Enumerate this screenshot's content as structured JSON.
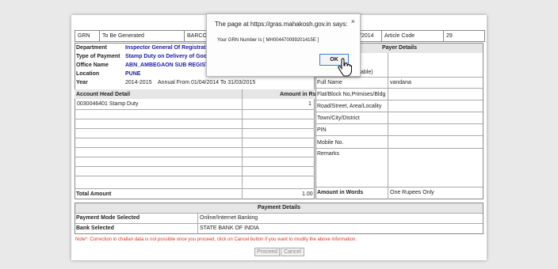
{
  "topbar": {
    "grn_label": "GRN",
    "grn_value": "To Be Generated",
    "barcode_label": "BARCOD",
    "date_value": "/2014",
    "article_label": "Article Code",
    "article_value": "29"
  },
  "department_info": {
    "department_label": "Department",
    "department_value": "Inspector General Of Registration",
    "type_label": "Type of Payment",
    "type_value": "Stamp Duty on Delivery of Goods",
    "office_label": "Office Name",
    "office_value": "ABN_AMBEGAON SUB REGISTRAR",
    "location_label": "Location",
    "location_value": "PUNE",
    "year_label": "Year",
    "year_value": "2014-2015",
    "year_range": "Annual From 01/04/2014 To 31/03/2015"
  },
  "account_table": {
    "col_head": "Account Head Detail",
    "col_amount": "Amount in Rs",
    "rows": [
      {
        "head": "0030046401   Stamp Duty",
        "amount": "1"
      }
    ],
    "total_label": "Total Amount",
    "total_value": "1.00"
  },
  "payer": {
    "header": "Payer Details",
    "partial_label": "able)",
    "full_name_label": "Full Name",
    "full_name_value": "vandana",
    "flat_label": "Flat/Block No,Primises/Bldg",
    "road_label": "Road/Street, Area/Locality",
    "town_label": "Town/City/District",
    "pin_label": "PIN",
    "mobile_label": "Mobile No.",
    "remarks_label": "Remarks",
    "words_label": "Amount in Words",
    "words_value": "One Rupees Only"
  },
  "payment": {
    "header": "Payment Details",
    "mode_label": "Payment Mode Selected",
    "mode_value": "Online/Internet Banking",
    "bank_label": "Bank Selected",
    "bank_value": "STATE BANK OF INDIA"
  },
  "note": "Note*: Correction in challan data is not possible once you proceed, click on Cancel button if you want to modify the above information.",
  "buttons": {
    "proceed": "Proceed",
    "cancel": "Cancel"
  },
  "dialog": {
    "title": "The page at https://gras.mahakosh.gov.in says:",
    "close": "×",
    "message": "Your GRN Number Is [ MH004470099201415E ]",
    "ok": "OK"
  }
}
